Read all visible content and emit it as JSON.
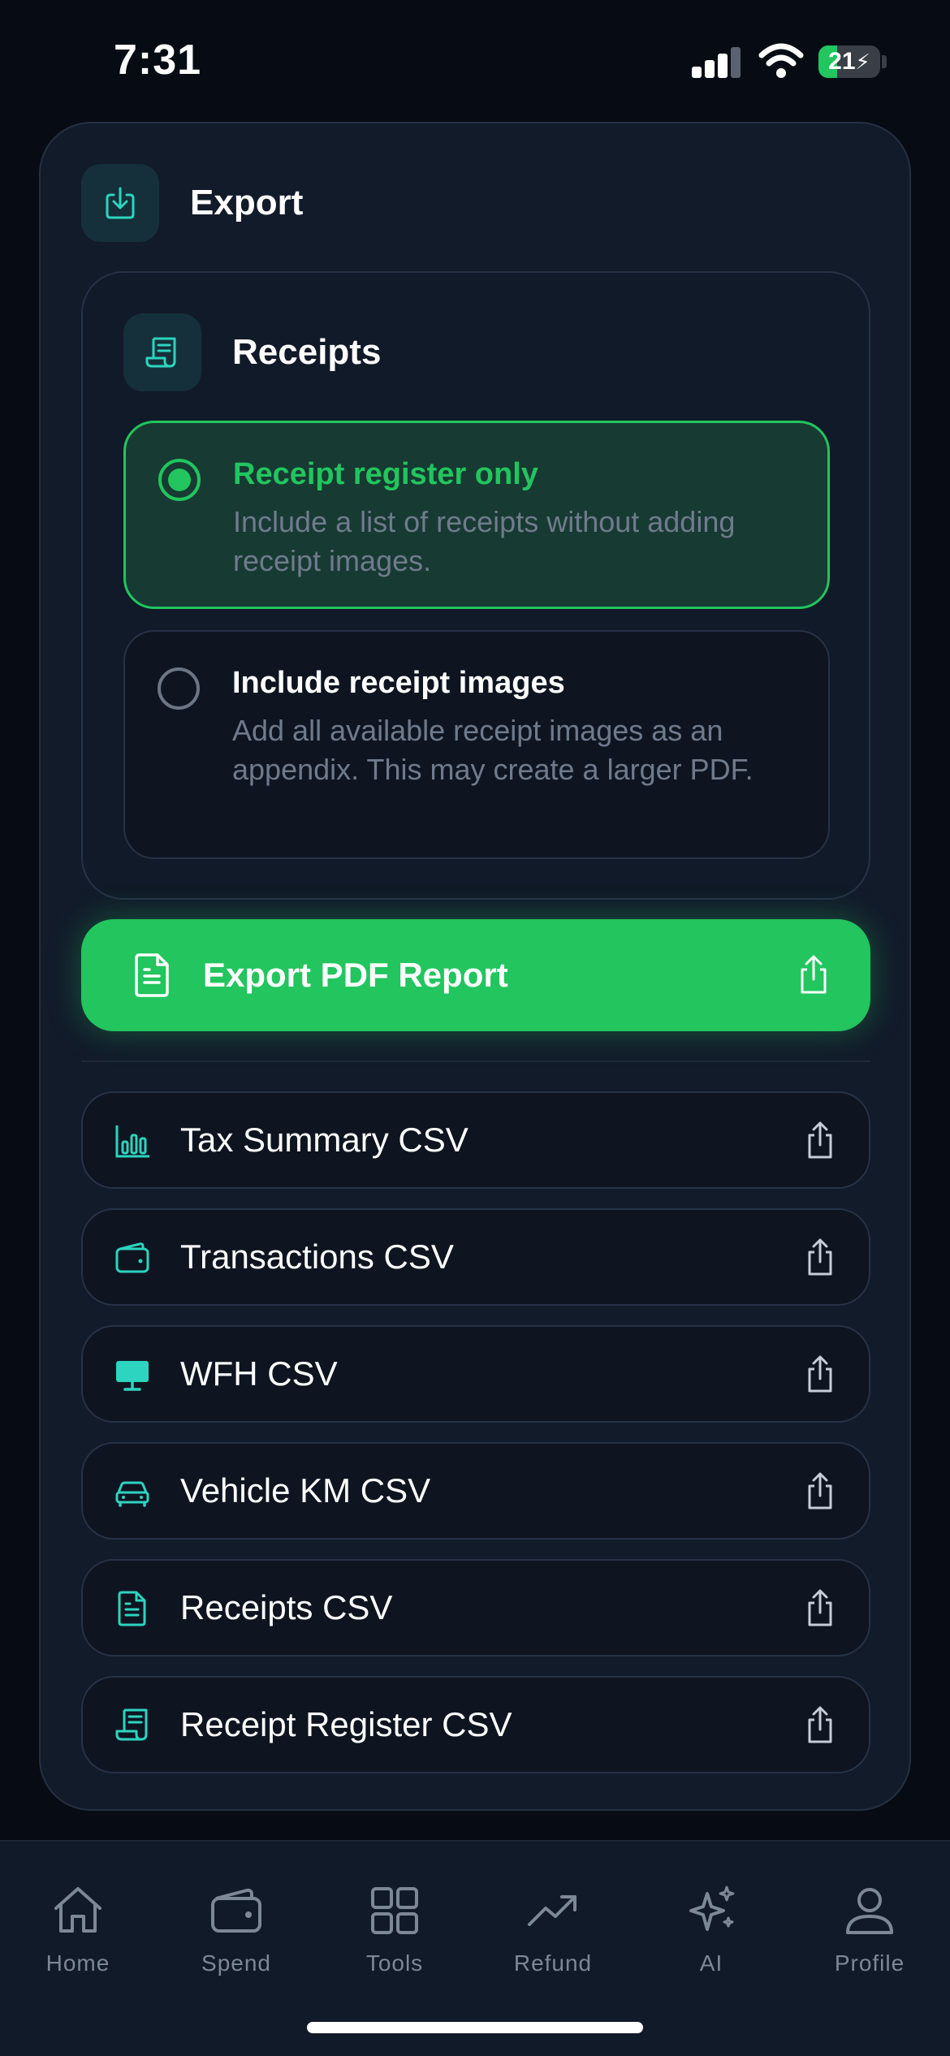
{
  "status_bar": {
    "time": "7:31",
    "battery": "21"
  },
  "export": {
    "title": "Export"
  },
  "receipts": {
    "title": "Receipts",
    "options": [
      {
        "title": "Receipt register only",
        "description": "Include a list of receipts without adding receipt images.",
        "selected": true
      },
      {
        "title": "Include receipt images",
        "description": "Add all available receipt images as an appendix. This may create a larger PDF.",
        "selected": false
      }
    ]
  },
  "pdf_button": {
    "label": "Export PDF Report"
  },
  "csv_exports": [
    {
      "label": "Tax Summary CSV",
      "icon": "bar-chart-icon"
    },
    {
      "label": "Transactions CSV",
      "icon": "wallet-icon"
    },
    {
      "label": "WFH CSV",
      "icon": "monitor-icon"
    },
    {
      "label": "Vehicle KM CSV",
      "icon": "car-icon"
    },
    {
      "label": "Receipts CSV",
      "icon": "document-icon"
    },
    {
      "label": "Receipt Register CSV",
      "icon": "receipt-icon"
    }
  ],
  "nav": [
    {
      "label": "Home",
      "icon": "home-icon"
    },
    {
      "label": "Spend",
      "icon": "wallet-icon"
    },
    {
      "label": "Tools",
      "icon": "grid-icon"
    },
    {
      "label": "Refund",
      "icon": "trending-up-icon"
    },
    {
      "label": "AI",
      "icon": "sparkles-icon"
    },
    {
      "label": "Profile",
      "icon": "user-icon"
    }
  ],
  "colors": {
    "accent": "#22c55e",
    "teal": "#2dd4bf",
    "background": "#070c14",
    "card": "#121b2a"
  }
}
